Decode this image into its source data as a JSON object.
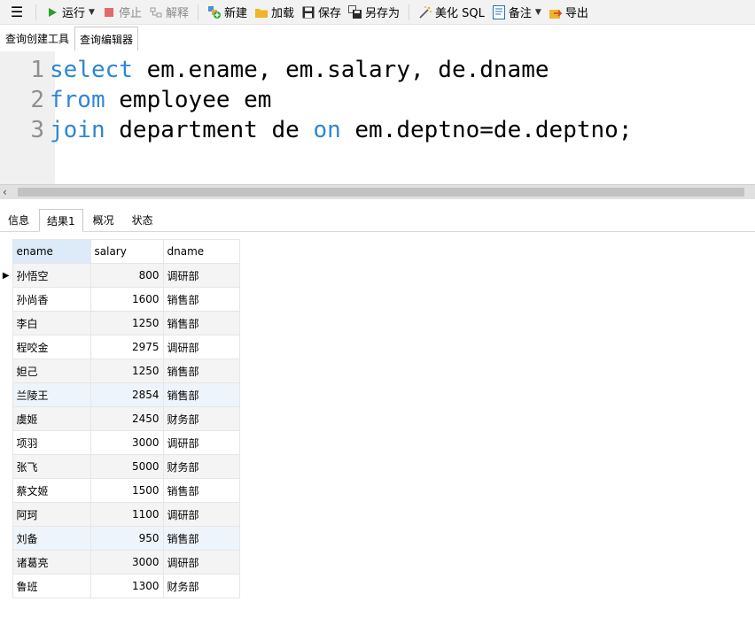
{
  "toolbar": {
    "menu_icon": "menu-icon",
    "run_label": "运行",
    "stop_label": "停止",
    "explain_label": "解释",
    "new_label": "新建",
    "load_label": "加载",
    "save_label": "保存",
    "save_as_label": "另存为",
    "beautify_label": "美化 SQL",
    "note_label": "备注",
    "export_label": "导出"
  },
  "editor_tabs": [
    "查询创建工具",
    "查询编辑器"
  ],
  "editor": {
    "lines": [
      {
        "num": "1",
        "parts": [
          [
            "kw",
            "select"
          ],
          [
            "tx",
            " em.ename, em.salary, de.dname"
          ]
        ]
      },
      {
        "num": "2",
        "parts": [
          [
            "kw",
            "from"
          ],
          [
            "tx",
            " employee em"
          ]
        ]
      },
      {
        "num": "3",
        "parts": [
          [
            "kw",
            "join"
          ],
          [
            "tx",
            " department de "
          ],
          [
            "kw",
            "on"
          ],
          [
            "tx",
            " em.deptno=de.deptno;"
          ]
        ]
      }
    ],
    "keyword_color": "#2f86d6"
  },
  "scroll_arrow": "‹",
  "result_tabs": [
    "信息",
    "结果1",
    "概况",
    "状态"
  ],
  "result": {
    "columns": [
      "ename",
      "salary",
      "dname"
    ],
    "rows": [
      [
        "孙悟空",
        "800",
        "调研部"
      ],
      [
        "孙尚香",
        "1600",
        "销售部"
      ],
      [
        "李白",
        "1250",
        "销售部"
      ],
      [
        "程咬金",
        "2975",
        "调研部"
      ],
      [
        "妲己",
        "1250",
        "销售部"
      ],
      [
        "兰陵王",
        "2854",
        "销售部"
      ],
      [
        "虞姬",
        "2450",
        "财务部"
      ],
      [
        "项羽",
        "3000",
        "调研部"
      ],
      [
        "张飞",
        "5000",
        "财务部"
      ],
      [
        "蔡文姬",
        "1500",
        "销售部"
      ],
      [
        "阿珂",
        "1100",
        "调研部"
      ],
      [
        "刘备",
        "950",
        "销售部"
      ],
      [
        "诸葛亮",
        "3000",
        "调研部"
      ],
      [
        "鲁班",
        "1300",
        "财务部"
      ]
    ],
    "current_row_marker": "▶"
  }
}
